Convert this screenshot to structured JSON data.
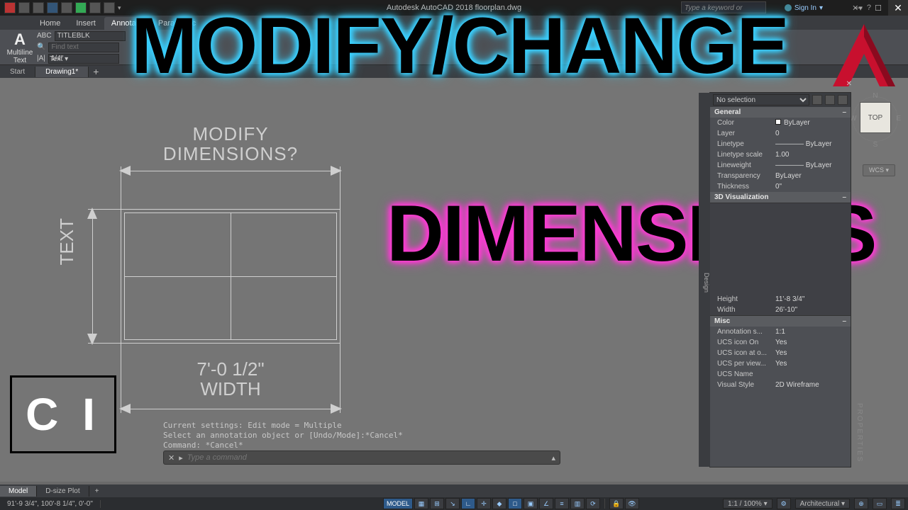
{
  "title": "Autodesk AutoCAD 2018   floorplan.dwg",
  "help_placeholder": "Type a keyword or phrase",
  "signin": "Sign In",
  "ribbon_tabs": [
    "Home",
    "Insert",
    "Annotate",
    "Parametric"
  ],
  "active_ribbon_tab": "Annotate",
  "multiline_label": "Multiline\nText",
  "text_panel_label": "Text ▾",
  "find": {
    "style_label": "ABC",
    "style_value": "TITLEBLK",
    "find_placeholder": "Find text",
    "height_value": "1/4\""
  },
  "doc_tabs": {
    "start": "Start",
    "drawing": "Drawing1*"
  },
  "drawing_labels": {
    "top_line1": "MODIFY",
    "top_line2": "DIMENSIONS?",
    "left": "TEXT",
    "bottom_line1": "7'-0  1/2\"",
    "bottom_line2": "WIDTH"
  },
  "ci_text": "C I",
  "cmd_history": "Current settings: Edit mode = Multiple\nSelect an annotation object or [Undo/Mode]:*Cancel*\nCommand: *Cancel*",
  "cmd_placeholder": "Type a command",
  "overlays": {
    "top": "MODIFY/CHANGE",
    "mid": "DIMENSIONS"
  },
  "viewcube": {
    "n": "N",
    "s": "S",
    "e": "E",
    "w": "W",
    "face": "TOP",
    "wcs": "WCS ▾"
  },
  "properties": {
    "title": "No selection",
    "sidetabs": "Design",
    "panel_label": "PROPERTIES",
    "sections": {
      "general": "General",
      "viz": "3D Visualization",
      "geom_hidden_rows": [
        {
          "k": "Height",
          "v": "11'-8 3/4\""
        },
        {
          "k": "Width",
          "v": "26'-10\""
        }
      ],
      "misc": "Misc"
    },
    "general_rows": [
      {
        "k": "Color",
        "v": "ByLayer",
        "swatch": true
      },
      {
        "k": "Layer",
        "v": "0"
      },
      {
        "k": "Linetype",
        "v": "———— ByLayer"
      },
      {
        "k": "Linetype scale",
        "v": "1.00"
      },
      {
        "k": "Lineweight",
        "v": "———— ByLayer"
      },
      {
        "k": "Transparency",
        "v": "ByLayer"
      },
      {
        "k": "Thickness",
        "v": "0\""
      }
    ],
    "misc_rows": [
      {
        "k": "Annotation s...",
        "v": "1:1"
      },
      {
        "k": "UCS icon On",
        "v": "Yes"
      },
      {
        "k": "UCS icon at o...",
        "v": "Yes"
      },
      {
        "k": "UCS per view...",
        "v": "Yes"
      },
      {
        "k": "UCS Name",
        "v": ""
      },
      {
        "k": "Visual Style",
        "v": "2D Wireframe"
      }
    ]
  },
  "layout_tabs": {
    "model": "Model",
    "dsize": "D-size Plot"
  },
  "statusbar": {
    "coords": "91'-9 3/4\", 100'-8 1/4\", 0'-0\"",
    "model": "MODEL",
    "scale": "1:1 / 100% ▾",
    "units": "Architectural ▾",
    "zoom": "⟳"
  }
}
